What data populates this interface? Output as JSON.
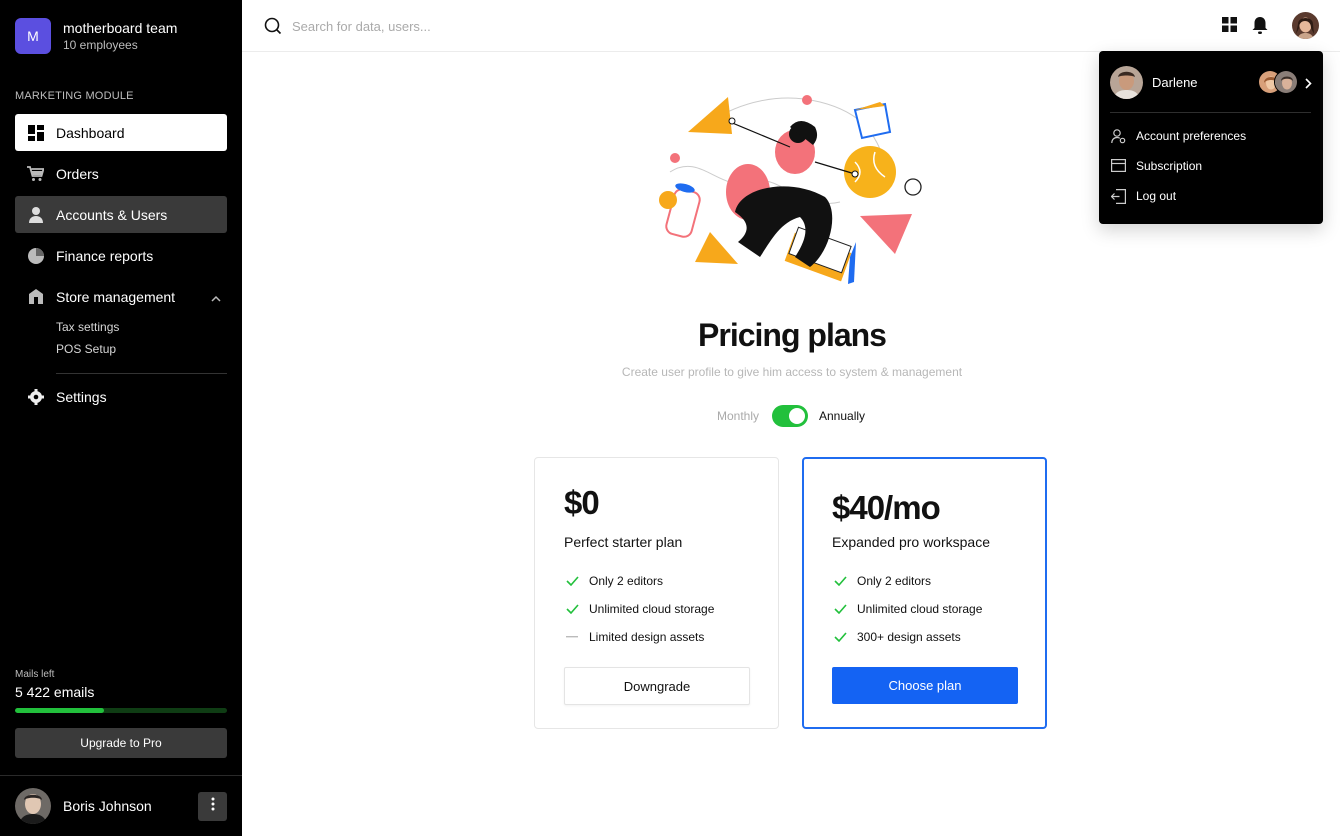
{
  "team": {
    "logo_letter": "M",
    "name": "motherboard team",
    "subtitle": "10 employees",
    "logo_color": "#5b4fe0"
  },
  "sidebar": {
    "section_label": "MARKETING MODULE",
    "items": [
      {
        "label": "Dashboard",
        "icon": "dashboard-icon",
        "state": "active"
      },
      {
        "label": "Orders",
        "icon": "cart-icon",
        "state": "default"
      },
      {
        "label": "Accounts & Users",
        "icon": "user-icon",
        "state": "hover"
      },
      {
        "label": "Finance reports",
        "icon": "pie-chart-icon",
        "state": "default"
      },
      {
        "label": "Store management",
        "icon": "store-icon",
        "state": "expanded"
      }
    ],
    "sub_items": [
      "Tax settings",
      "POS Setup"
    ],
    "settings_label": "Settings",
    "mails": {
      "label": "Mails left",
      "value": "5 422 emails",
      "progress_fraction": 0.42
    },
    "upgrade_label": "Upgrade to Pro",
    "user": {
      "name": "Boris Johnson"
    }
  },
  "topbar": {
    "search_placeholder": "Search for data, users...",
    "icons": [
      "apps-grid-icon",
      "bell-icon"
    ]
  },
  "dropdown": {
    "user_name": "Darlene",
    "items": [
      {
        "label": "Account preferences",
        "icon": "user-settings-icon"
      },
      {
        "label": "Subscription",
        "icon": "card-icon"
      },
      {
        "label": "Log out",
        "icon": "logout-icon"
      }
    ]
  },
  "pricing": {
    "title": "Pricing plans",
    "subtitle": "Create user profile to give him access to system & management",
    "toggle": {
      "left": "Monthly",
      "right": "Annually",
      "selected": "Annually"
    },
    "plans": [
      {
        "price": "$0",
        "description": "Perfect starter plan",
        "features": [
          {
            "text": "Only 2 editors",
            "included": true
          },
          {
            "text": "Unlimited cloud storage",
            "included": true
          },
          {
            "text": "Limited design assets",
            "included": false
          }
        ],
        "button": "Downgrade"
      },
      {
        "price": "$40/mo",
        "description": "Expanded pro workspace",
        "features": [
          {
            "text": "Only 2 editors",
            "included": true
          },
          {
            "text": "Unlimited cloud storage",
            "included": true
          },
          {
            "text": "300+ design assets",
            "included": true
          }
        ],
        "button": "Choose plan"
      }
    ]
  },
  "colors": {
    "accent_blue": "#1463f3",
    "success_green": "#22c03c",
    "sidebar_bg": "#000000"
  }
}
